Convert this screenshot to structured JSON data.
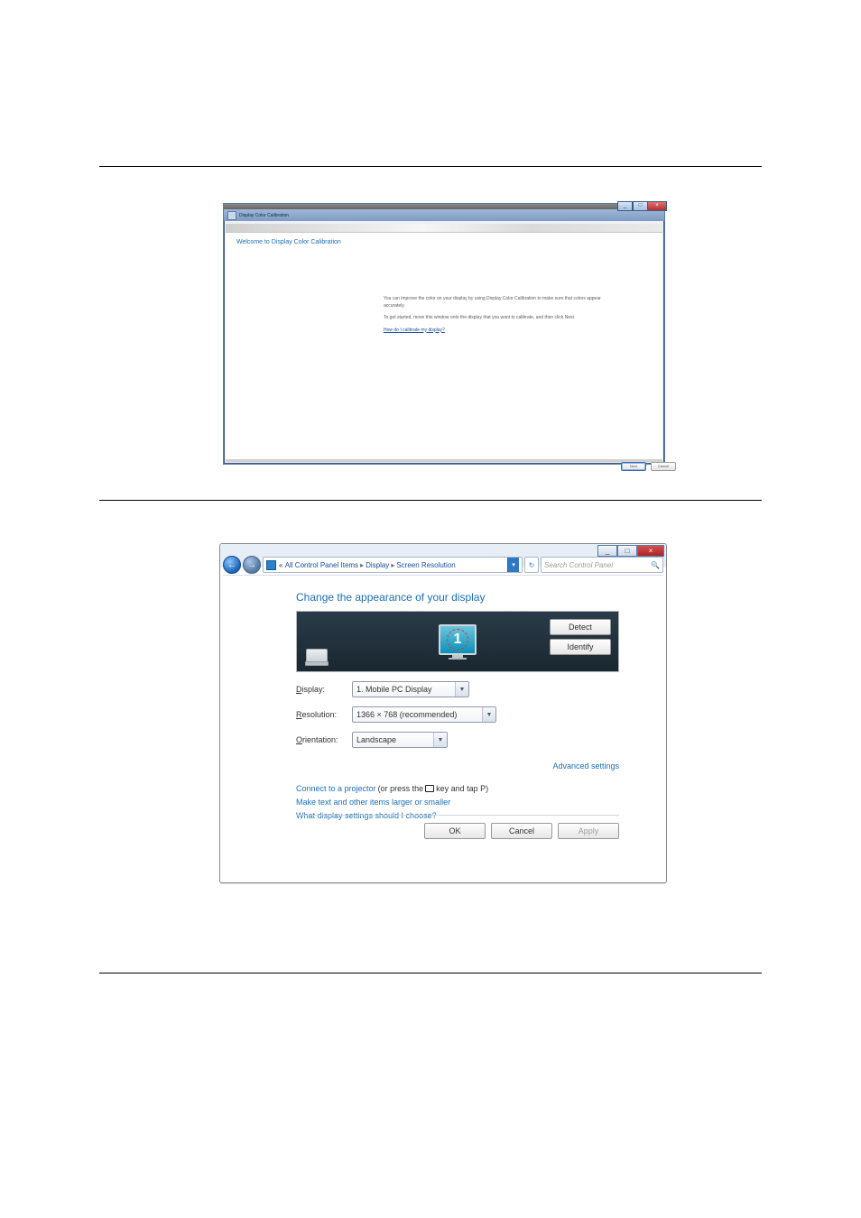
{
  "win1": {
    "title": "Display Color Calibration",
    "heading": "Welcome to Display Color Calibration",
    "para1": "You can improve the color on your display by using Display Color Calibration to make sure that colors appear accurately.",
    "para2": "To get started, move this window onto the display that you want to calibrate, and then click Next.",
    "help_link": "How do I calibrate my display?",
    "btn_next": "Next",
    "btn_cancel": "Cancel",
    "wc_min": "_",
    "wc_max": "□",
    "wc_close": "×"
  },
  "win2": {
    "wc_min": "_",
    "wc_max": "□",
    "wc_close": "×",
    "nav_back": "←",
    "nav_fwd": "→",
    "crumb_prefix": "«",
    "crumb1": "All Control Panel Items",
    "crumb2": "Display",
    "crumb3": "Screen Resolution",
    "crumb_sep": "▸",
    "addr_dd": "▾",
    "refresh": "↻",
    "search_placeholder": "Search Control Panel",
    "search_icon": "🔍",
    "heading": "Change the appearance of your display",
    "monitor_number": "1",
    "btn_detect": "Detect",
    "btn_identify": "Identify",
    "label_display": "Display:",
    "label_display_u": "D",
    "label_resolution": "Resolution:",
    "label_resolution_u": "R",
    "label_orientation": "Orientation:",
    "label_orientation_u": "O",
    "display_value": "1. Mobile PC Display",
    "resolution_value": "1366 × 768 (recommended)",
    "orientation_value": "Landscape",
    "dd_arrow": "▼",
    "adv_link": "Advanced settings",
    "link_projector_a": "Connect to a projector",
    "link_projector_b": " (or press the ",
    "link_projector_c": " key and tap P)",
    "link_textsize": "Make text and other items larger or smaller",
    "link_which": "What display settings should I choose?",
    "btn_ok": "OK",
    "btn_cancel": "Cancel",
    "btn_apply": "Apply"
  }
}
